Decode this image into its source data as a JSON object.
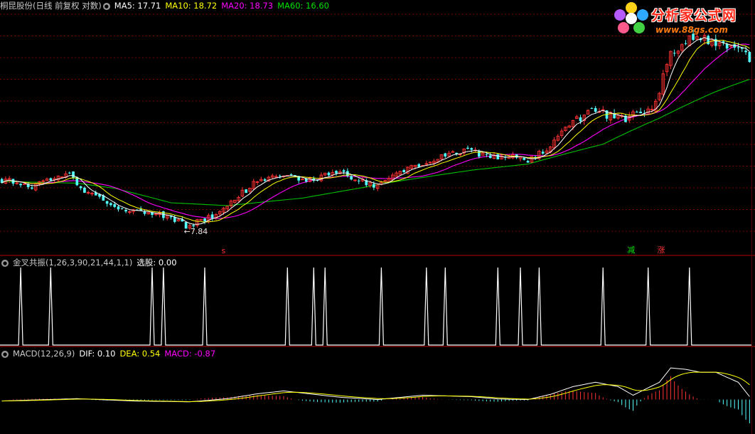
{
  "colors": {
    "background": "#000000",
    "grid": "#7a0000",
    "separator": "#b30000",
    "up_candle": "#ff3232",
    "down_candle": "#54ffff",
    "ma5": "#ffffff",
    "ma10": "#ffff00",
    "ma20": "#ff00ff",
    "ma60": "#00c000",
    "signal_line": "#ffffff",
    "dif": "#ffffff",
    "dea": "#ffff00",
    "macd_pos": "#ff3232",
    "macd_neg": "#54ffff"
  },
  "icons": [
    "settings-dot-icon",
    "settings-dot-icon",
    "settings-dot-icon",
    "flower-logo-icon"
  ],
  "header_main": {
    "title": "桐昆股份(日线 前复权 对数)",
    "ma5": "MA5: 17.71",
    "ma10": "MA10: 18.72",
    "ma20": "MA20: 18.73",
    "ma60": "MA60: 16.60"
  },
  "header_ind": {
    "title": "金叉共振(1,26,3,90,21,44,1,1)",
    "value": "选股: 0.00"
  },
  "header_macd": {
    "title": "MACD(12,26,9)",
    "dif": "DIF: 0.10",
    "dea": "DEA: 0.54",
    "macd": "MACD: -0.87"
  },
  "logo": {
    "text1": "分析家公式网",
    "text2": "www.88gs.com"
  },
  "markers": {
    "low_label": "7.84",
    "s_label": "s",
    "jian_label": "减",
    "zhang_label": "涨"
  },
  "chart_data": [
    {
      "type": "line",
      "name": "price",
      "log_scale": true,
      "grid": true,
      "x_count": 200,
      "ylim": [
        6.8,
        27.5
      ],
      "low_value": 7.84,
      "low_index": 49,
      "price_path": [
        [
          0,
          10.3
        ],
        [
          8,
          9.95
        ],
        [
          14,
          10.45
        ],
        [
          18,
          10.6
        ],
        [
          22,
          9.7
        ],
        [
          30,
          8.8
        ],
        [
          38,
          8.45
        ],
        [
          44,
          8.3
        ],
        [
          49,
          7.84
        ],
        [
          56,
          8.3
        ],
        [
          62,
          9.2
        ],
        [
          68,
          10.2
        ],
        [
          75,
          10.5
        ],
        [
          82,
          10.3
        ],
        [
          90,
          10.8
        ],
        [
          96,
          10.2
        ],
        [
          100,
          9.9
        ],
        [
          106,
          10.7
        ],
        [
          112,
          11.4
        ],
        [
          118,
          11.8
        ],
        [
          124,
          12.3
        ],
        [
          130,
          11.7
        ],
        [
          136,
          11.9
        ],
        [
          140,
          11.45
        ],
        [
          146,
          12.6
        ],
        [
          152,
          14.5
        ],
        [
          158,
          15.5
        ],
        [
          164,
          14.7
        ],
        [
          170,
          15.1
        ],
        [
          174,
          16.2
        ],
        [
          178,
          21.5
        ],
        [
          182,
          23.5
        ],
        [
          187,
          23.5
        ],
        [
          192,
          22.7
        ],
        [
          196,
          22.8
        ],
        [
          199,
          20.5
        ]
      ],
      "ma60_path": [
        [
          0,
          10.2
        ],
        [
          20,
          10.1
        ],
        [
          30,
          9.8
        ],
        [
          45,
          9.0
        ],
        [
          60,
          8.85
        ],
        [
          80,
          9.25
        ],
        [
          95,
          9.8
        ],
        [
          105,
          10.2
        ],
        [
          125,
          10.9
        ],
        [
          140,
          11.3
        ],
        [
          160,
          12.7
        ],
        [
          175,
          14.8
        ],
        [
          190,
          17.3
        ],
        [
          199,
          18.6
        ]
      ],
      "signal_bars": [
        5,
        13,
        40,
        43,
        54,
        76,
        83,
        86,
        101,
        113,
        118,
        132,
        138,
        143,
        160,
        172,
        183
      ]
    },
    {
      "type": "bar",
      "name": "MACD",
      "x_count": 200,
      "ylim": [
        -1.1,
        1.4
      ],
      "dif_path": [
        [
          0,
          -0.05
        ],
        [
          20,
          0.03
        ],
        [
          35,
          -0.05
        ],
        [
          50,
          -0.08
        ],
        [
          60,
          0.03
        ],
        [
          68,
          0.2
        ],
        [
          75,
          0.3
        ],
        [
          90,
          0.08
        ],
        [
          100,
          0.0
        ],
        [
          112,
          0.15
        ],
        [
          125,
          0.1
        ],
        [
          132,
          0.02
        ],
        [
          140,
          0.0
        ],
        [
          146,
          0.18
        ],
        [
          152,
          0.45
        ],
        [
          158,
          0.6
        ],
        [
          164,
          0.45
        ],
        [
          168,
          0.15
        ],
        [
          175,
          0.6
        ],
        [
          178,
          1.1
        ],
        [
          182,
          1.05
        ],
        [
          186,
          0.95
        ],
        [
          190,
          0.95
        ],
        [
          196,
          0.6
        ],
        [
          199,
          0.1
        ]
      ],
      "macd_series": "MACD"
    }
  ]
}
